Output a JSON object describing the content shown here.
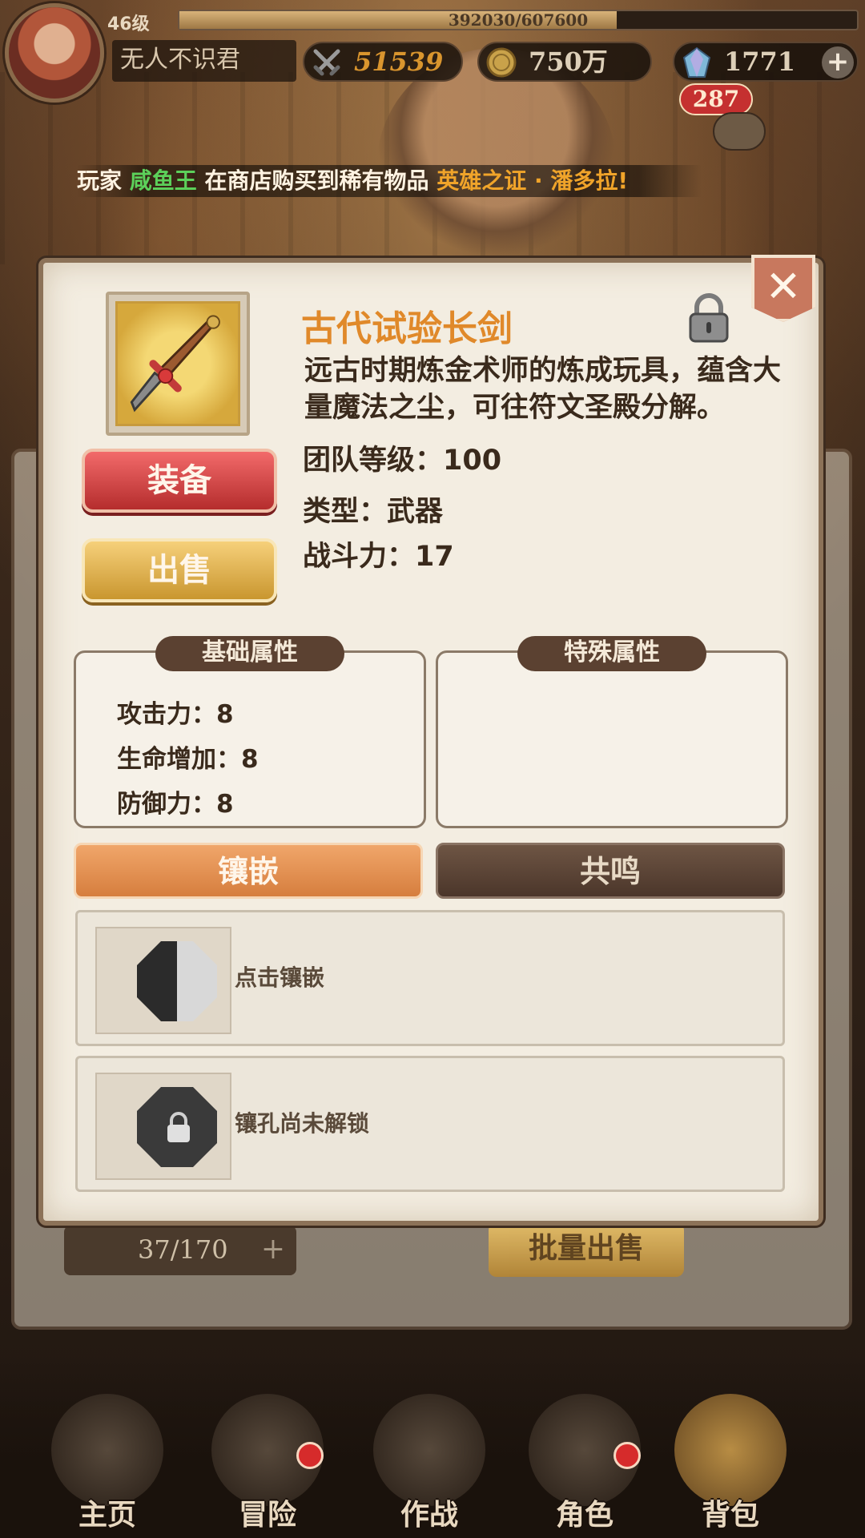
{
  "top_bar": {
    "level": "46级",
    "exp_text": "392030/607600",
    "exp_fraction": 0.645,
    "player_name": "无人不识君",
    "power": "51539",
    "gold": "750万",
    "gems": "1771",
    "chat_count": "287"
  },
  "announcement": {
    "prefix": "玩家 ",
    "player": "咸鱼王",
    "middle": " 在商店购买到稀有物品 ",
    "item": "英雄之证 · 潘多拉!"
  },
  "item": {
    "name": "古代试验长剑",
    "description": "远古时期炼金术师的炼成玩具，蕴含大量魔法之尘，可往符文圣殿分解。",
    "team_level": "团队等级：100",
    "type": "类型：武器",
    "power": "战斗力：17",
    "equip_label": "装备",
    "sell_label": "出售"
  },
  "attributes": {
    "base_title": "基础属性",
    "special_title": "特殊属性",
    "base": [
      "攻击力：8",
      "生命增加：8",
      "防御力：8"
    ]
  },
  "tabs": {
    "inlay": "镶嵌",
    "resonance": "共鸣"
  },
  "slots": [
    {
      "text": "点击镶嵌"
    },
    {
      "text": "镶孔尚未解锁"
    }
  ],
  "inventory": {
    "count": "37/170",
    "bulk_sell": "批量出售"
  },
  "bottom_nav": [
    {
      "label": "主页"
    },
    {
      "label": "冒险"
    },
    {
      "label": "作战"
    },
    {
      "label": "角色"
    },
    {
      "label": "背包"
    }
  ],
  "colors": {
    "item_name": "#e0892a",
    "equip_button": "#d84444",
    "sell_button": "#e0ae48",
    "active_tab": "#e08a4a",
    "announce_player": "#5cd05a",
    "announce_item": "#f0a42a"
  }
}
